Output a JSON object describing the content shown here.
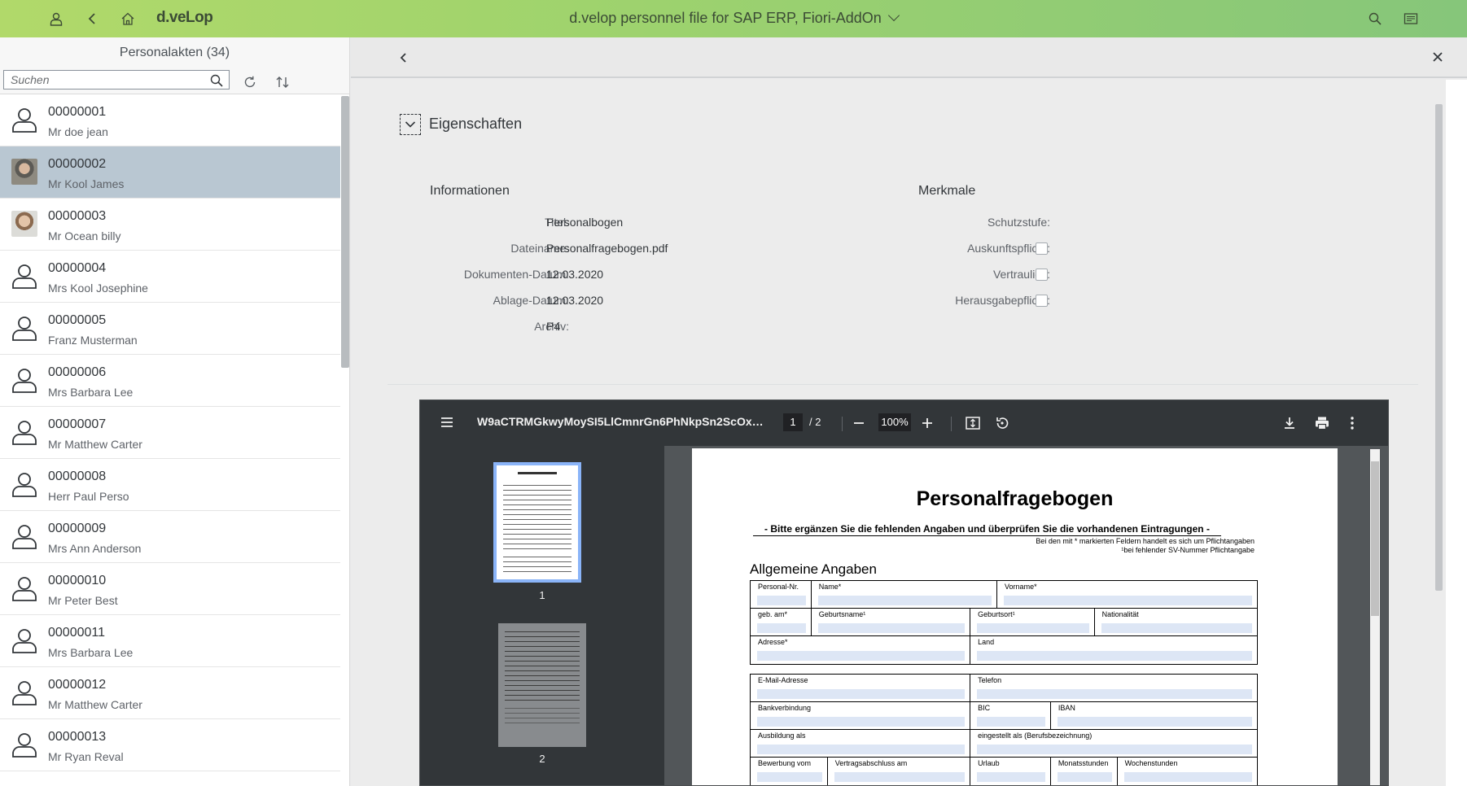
{
  "shell": {
    "brand": "d.veLop",
    "title": "d.velop personnel file for SAP ERP, Fiori-AddOn"
  },
  "master": {
    "header": "Personalakten (34)",
    "search_placeholder": "Suchen",
    "items": [
      {
        "id": "00000001",
        "name": "Mr doe jean",
        "avatar": "person-icon"
      },
      {
        "id": "00000002",
        "name": "Mr Kool James",
        "avatar": "photo"
      },
      {
        "id": "00000003",
        "name": "Mr Ocean billy",
        "avatar": "photo"
      },
      {
        "id": "00000004",
        "name": "Mrs Kool Josephine",
        "avatar": "person-icon"
      },
      {
        "id": "00000005",
        "name": "Franz Musterman",
        "avatar": "person-icon"
      },
      {
        "id": "00000006",
        "name": "Mrs Barbara Lee",
        "avatar": "person-icon"
      },
      {
        "id": "00000007",
        "name": "Mr Matthew Carter",
        "avatar": "person-icon"
      },
      {
        "id": "00000008",
        "name": "Herr Paul Perso",
        "avatar": "person-icon"
      },
      {
        "id": "00000009",
        "name": "Mrs Ann Anderson",
        "avatar": "person-icon"
      },
      {
        "id": "00000010",
        "name": "Mr Peter Best",
        "avatar": "person-icon"
      },
      {
        "id": "00000011",
        "name": "Mrs Barbara Lee",
        "avatar": "person-icon"
      },
      {
        "id": "00000012",
        "name": "Mr Matthew Carter",
        "avatar": "person-icon"
      },
      {
        "id": "00000013",
        "name": "Mr Ryan Reval",
        "avatar": "person-icon"
      }
    ],
    "selected_index": 1
  },
  "detail": {
    "properties_title": "Eigenschaften",
    "info_title": "Informationen",
    "features_title": "Merkmale",
    "info": [
      {
        "label": "Titel:",
        "value": "Personalbogen"
      },
      {
        "label": "Dateiname:",
        "value": "Personalfragebogen.pdf"
      },
      {
        "label": "Dokumenten-Datum:",
        "value": "12.03.2020"
      },
      {
        "label": "Ablage-Datum:",
        "value": "12.03.2020"
      },
      {
        "label": "Archiv:",
        "value": "P4"
      }
    ],
    "features": [
      {
        "label": "Schutzstufe:",
        "type": "text",
        "value": ""
      },
      {
        "label": "Auskunftspflicht:",
        "type": "checkbox",
        "checked": false
      },
      {
        "label": "Vertraulich:",
        "type": "checkbox",
        "checked": false
      },
      {
        "label": "Herausgabepflicht:",
        "type": "checkbox",
        "checked": false
      }
    ]
  },
  "pdf": {
    "filename": "W9aCTRMGkwyMoySI5LlCmnrGn6PhNkpSn2ScOxoOo...",
    "page": "1",
    "total": "/  2",
    "zoom": "100%",
    "thumbs": [
      "1",
      "2"
    ],
    "doc": {
      "title": "Personalfragebogen",
      "subtitle": "- Bitte ergänzen Sie die fehlenden Angaben und überprüfen Sie die vorhandenen Eintragungen -",
      "note1": "Bei den mit * markierten Feldern handelt es sich um Pflichtangaben",
      "note2": "¹bei fehlender SV-Nummer Pflichtangabe",
      "section": "Allgemeine Angaben",
      "table1": [
        [
          "Personal-Nr.",
          "Name*",
          "Vorname*"
        ],
        [
          "geb. am*",
          "Geburtsname¹",
          "Geburtsort¹",
          "Nationalität"
        ],
        [
          "Adresse*",
          "Land"
        ]
      ],
      "table2": [
        [
          "E-Mail-Adresse",
          "Telefon"
        ],
        [
          "Bankverbindung",
          "BIC",
          "IBAN"
        ],
        [
          "Ausbildung als",
          "eingestellt als (Berufsbezeichnung)"
        ],
        [
          "Bewerbung vom",
          "Vertragsabschluss am",
          "Urlaub",
          "Monatsstunden",
          "Wochenstunden"
        ]
      ]
    }
  }
}
